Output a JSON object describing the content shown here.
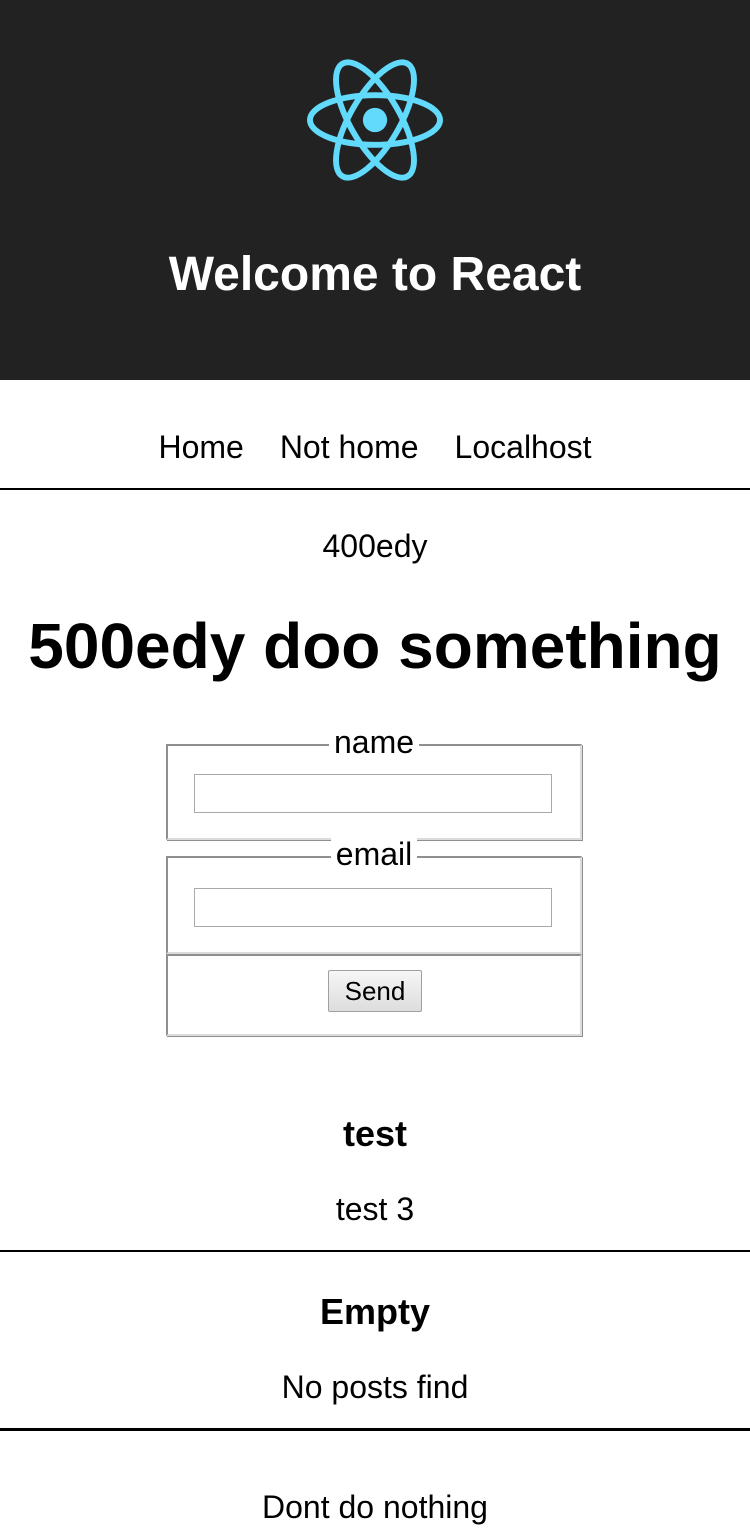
{
  "header": {
    "title": "Welcome to React",
    "logo_color": "#61dafb",
    "background": "#222222"
  },
  "nav": {
    "items": [
      "Home",
      "Not home",
      "Localhost"
    ]
  },
  "status_text": "400edy",
  "main_heading": "500edy doo something",
  "form": {
    "name_legend": "name",
    "name_value": "",
    "email_legend": "email",
    "email_value": "",
    "send_label": "Send"
  },
  "sections": [
    {
      "title": "test",
      "body": "test 3"
    },
    {
      "title": "Empty",
      "body": "No posts find"
    }
  ],
  "footer_text": "Dont do nothing"
}
